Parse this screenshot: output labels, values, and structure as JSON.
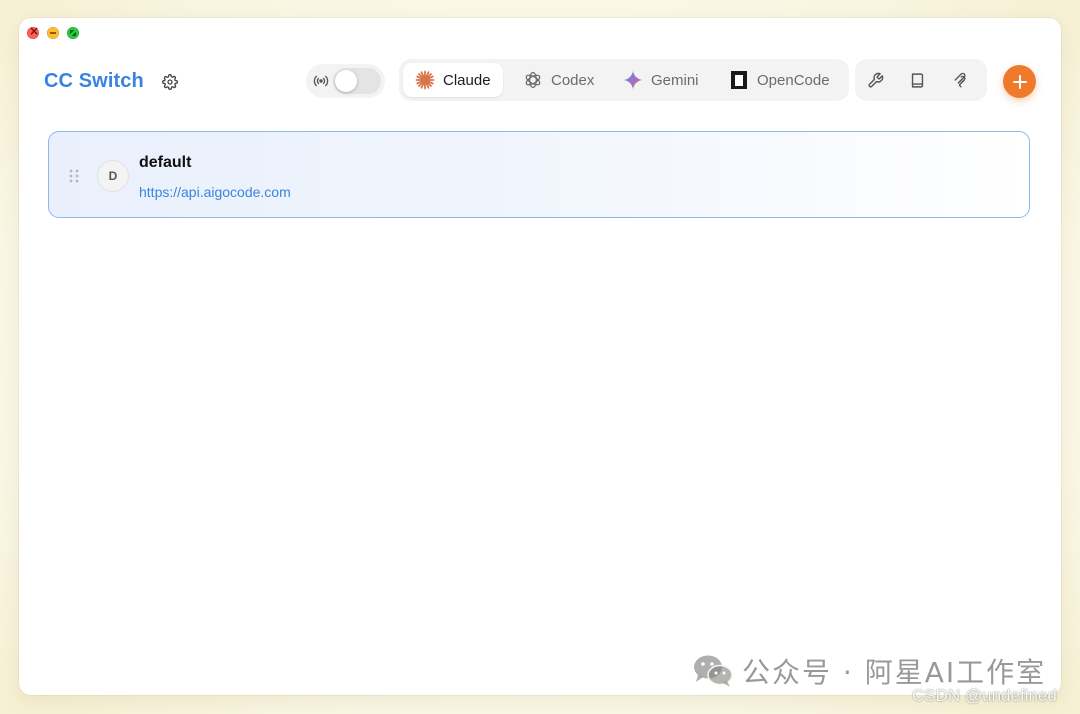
{
  "app": {
    "title": "CC Switch"
  },
  "tabs": [
    {
      "label": "Claude",
      "active": true,
      "icon": "claude-sunburst-icon"
    },
    {
      "label": "Codex",
      "active": false,
      "icon": "openai-knot-icon"
    },
    {
      "label": "Gemini",
      "active": false,
      "icon": "gemini-spark-icon"
    },
    {
      "label": "OpenCode",
      "active": false,
      "icon": "opencode-square-icon"
    }
  ],
  "proxy": {
    "icon": "broadcast-icon",
    "enabled": false
  },
  "tools": [
    {
      "icon": "wrench-icon"
    },
    {
      "icon": "book-icon"
    },
    {
      "icon": "mcp-icon"
    }
  ],
  "providers": [
    {
      "avatar_letter": "D",
      "name": "default",
      "url": "https://api.aigocode.com",
      "selected": true
    }
  ],
  "watermark": {
    "text": "公众号 · 阿星AI工作室",
    "credit": "CSDN @undefined"
  },
  "colors": {
    "brand": "#3a84e0",
    "accent": "#f07a2c",
    "selected_border": "#8cb8ee"
  }
}
